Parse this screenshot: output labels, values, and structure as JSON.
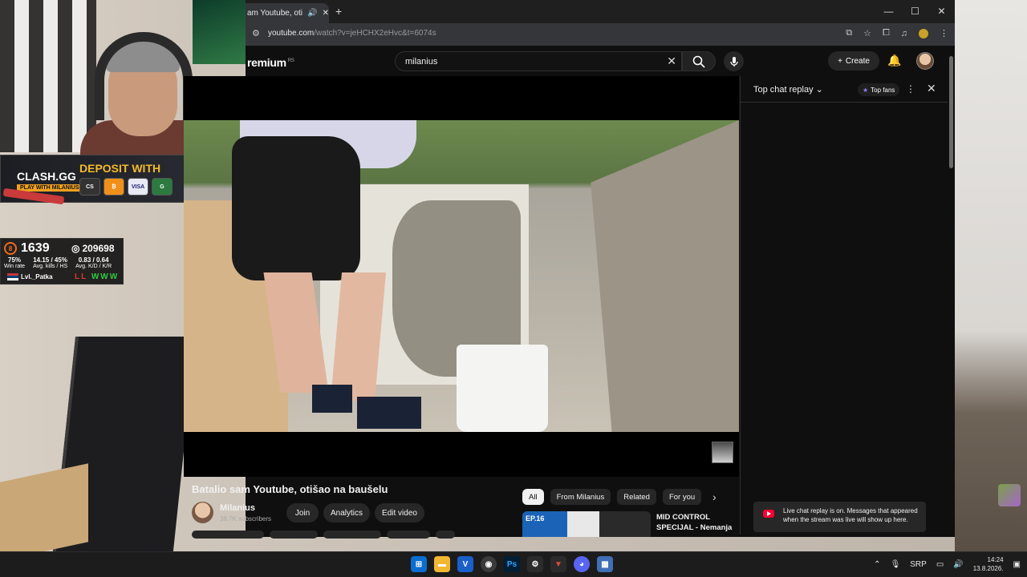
{
  "overlay": {
    "clash_logo": "CLASH.GG",
    "clash_sub": "PLAY WITH MILANIUS",
    "deposit_text": "DEPOSIT WITH",
    "payments": [
      "CS",
      "₿",
      "VISA",
      "G"
    ],
    "faceit": {
      "level": "8",
      "elo": "1639",
      "points": "209698",
      "stats": [
        {
          "value": "75%",
          "label": "Win rate"
        },
        {
          "value": "14.15 / 45%",
          "label": "Avg. kills / HS"
        },
        {
          "value": "0.83 / 0.64",
          "label": "Avg. K/D / K/R"
        }
      ],
      "player": "Lvl._Patka",
      "results_l": "LL",
      "results_w": "WWW"
    }
  },
  "browser": {
    "tab_title": "am Youtube, otišao",
    "new_tab": "+",
    "controls": [
      "—",
      "☐",
      "✕"
    ],
    "url_host": "youtube.com",
    "url_path": "/watch?v=jeHCHX2eHvc&t=6074s"
  },
  "youtube": {
    "logo_text": "remium",
    "logo_region": "RS",
    "search_value": "milanius",
    "create_label": "Create",
    "video_title": "Batalio sam Youtube, otišao na baušelu",
    "channel_name": "Milanius",
    "channel_subs": "38.7K subscribers",
    "buttons": {
      "join": "Join",
      "analytics": "Analytics",
      "edit": "Edit video"
    },
    "chips": [
      "All",
      "From Milanius",
      "Related",
      "For you"
    ],
    "rec_title": "MID CONTROL SPECIJAL - Nemanja",
    "rec_badge": "EP.16"
  },
  "chat": {
    "title": "Top chat replay",
    "top_fans": "Top fans",
    "notice": "Live chat replay is on. Messages that appeared when the stream was live will show up here."
  },
  "taskbar": {
    "language": "SRP",
    "time": "14:24",
    "date": "13.8.2026."
  }
}
